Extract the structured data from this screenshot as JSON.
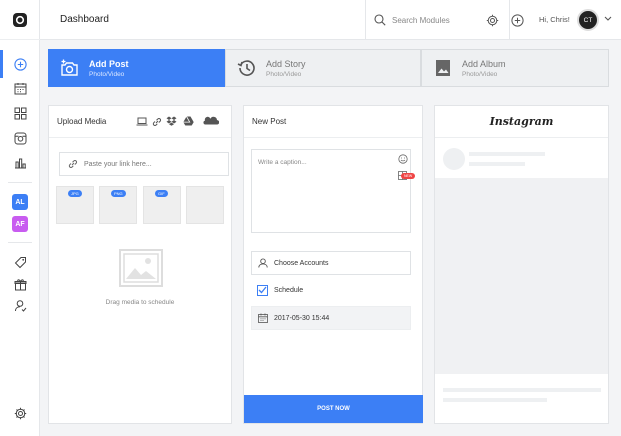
{
  "header": {
    "title": "Dashboard",
    "search_placeholder": "Search Modules",
    "greeting": "Hi, Chris!",
    "avatar_initials": "CT"
  },
  "sidebar": {
    "accounts": [
      {
        "initials": "AL",
        "color": "#3c7ff5"
      },
      {
        "initials": "AF",
        "color": "#c85cf0"
      }
    ]
  },
  "tabs": [
    {
      "label": "Add Post",
      "sub": "Photo/Video",
      "active": true,
      "icon": "camera-plus-icon"
    },
    {
      "label": "Add Story",
      "sub": "Photo/Video",
      "active": false,
      "icon": "history-icon"
    },
    {
      "label": "Add Album",
      "sub": "Photo/Video",
      "active": false,
      "icon": "album-icon"
    }
  ],
  "upload": {
    "title": "Upload Media",
    "link_placeholder": "Paste your link here...",
    "badges": [
      "JPG",
      "PNG",
      "GIF"
    ],
    "drop_text": "Drag media to schedule"
  },
  "new_post": {
    "title": "New Post",
    "caption_placeholder": "Write a caption...",
    "new_badge": "NEW",
    "choose_accounts": "Choose Accounts",
    "schedule_label": "Schedule",
    "schedule_date": "2017-05-30 15:44",
    "post_button": "POST NOW"
  },
  "preview": {
    "title": "Instagram"
  },
  "colors": {
    "accent": "#3c7ff5",
    "new_badge": "#ef4444"
  }
}
